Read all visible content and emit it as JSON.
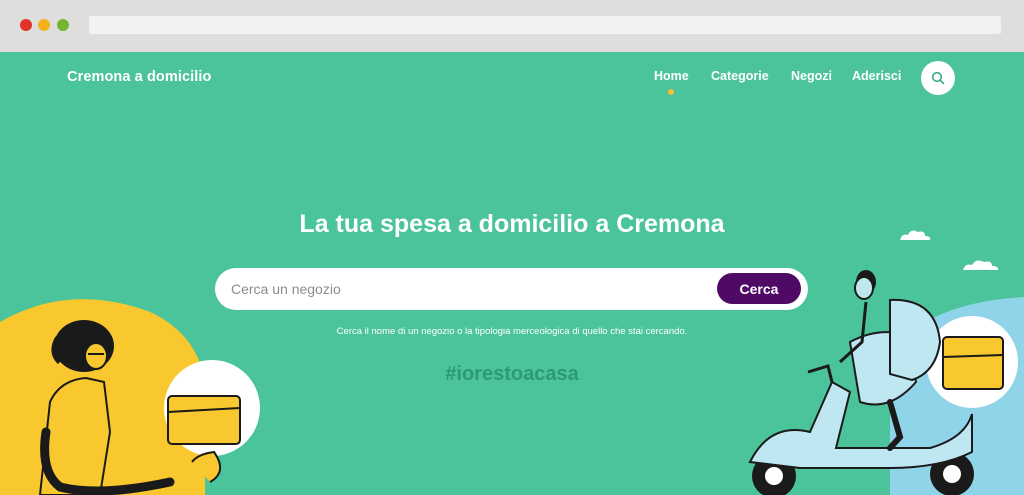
{
  "header": {
    "brand": "Cremona a domicilio",
    "nav": [
      {
        "label": "Home",
        "active": true
      },
      {
        "label": "Categorie"
      },
      {
        "label": "Negozi"
      },
      {
        "label": "Aderisci"
      }
    ],
    "search_icon": "search-icon"
  },
  "hero": {
    "title": "La tua spesa a domicilio a Cremona",
    "search": {
      "placeholder": "Cerca un negozio",
      "value": "",
      "button_label": "Cerca"
    },
    "hint": "Cerca il nome di un negozio o la tipologia merceologica di quello che stai cercando.",
    "hashtag": "#iorestoacasa"
  },
  "colors": {
    "background": "#4bc49c",
    "accent": "#4f0a66",
    "active_dot": "#f6c12b",
    "hashtag": "#2c9a75"
  }
}
